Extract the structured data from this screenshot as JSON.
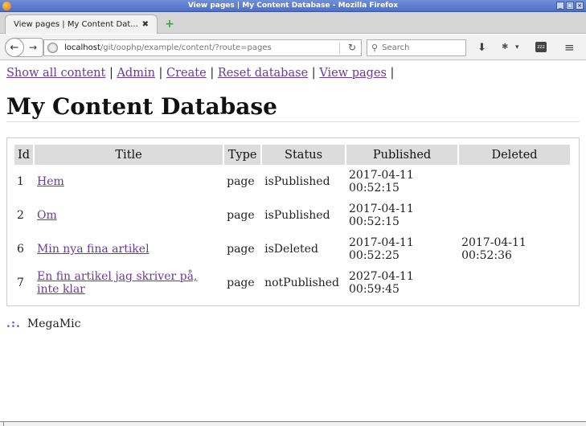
{
  "window": {
    "title": "View pages | My Content Database - Mozilla Firefox",
    "buttons": [
      "_",
      "□",
      "×"
    ]
  },
  "tab": {
    "title": "View pages | My Content Dat...",
    "close": "✖",
    "new_tab": "+"
  },
  "nav": {
    "back": "←",
    "forward": "→",
    "url_host": "localhost",
    "url_path": "/git/oophp/example/content/?route=pages",
    "reload": "↻",
    "search_placeholder": "Search"
  },
  "toolbar": {
    "download": "⬇",
    "addon": "✱",
    "addon_caret": "▾",
    "zzz": "zzz",
    "menu": "≡"
  },
  "page": {
    "links": [
      "Show all content",
      "Admin",
      "Create",
      "Reset database",
      "View pages"
    ],
    "separator": "|",
    "title": "My Content Database",
    "table": {
      "headers": [
        "Id",
        "Title",
        "Type",
        "Status",
        "Published",
        "Deleted"
      ],
      "rows": [
        {
          "id": "1",
          "title": "Hem",
          "type": "page",
          "status": "isPublished",
          "published": [
            "2017-04-11",
            "00:52:15"
          ],
          "deleted": [
            "",
            ""
          ]
        },
        {
          "id": "2",
          "title": "Om",
          "type": "page",
          "status": "isPublished",
          "published": [
            "2017-04-11",
            "00:52:15"
          ],
          "deleted": [
            "",
            ""
          ]
        },
        {
          "id": "6",
          "title": "Min nya fina artikel",
          "type": "page",
          "status": "isDeleted",
          "published": [
            "2017-04-11",
            "00:52:25"
          ],
          "deleted": [
            "2017-04-11",
            "00:52:36"
          ]
        },
        {
          "id": "7",
          "title": "En fin artikel jag skriver på, inte klar",
          "type": "page",
          "status": "notPublished",
          "published": [
            "2027-04-11",
            "00:59:45"
          ],
          "deleted": [
            "",
            ""
          ]
        }
      ]
    },
    "footer": {
      "dots": ".:.",
      "text": "MegaMic"
    }
  }
}
